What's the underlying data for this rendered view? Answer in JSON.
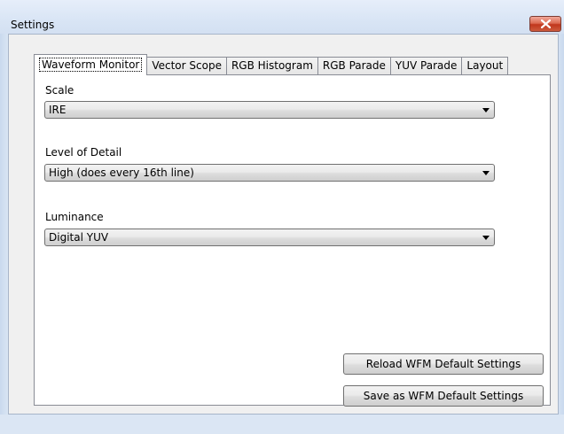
{
  "window": {
    "title": "Settings"
  },
  "tabs": [
    {
      "label": "Waveform Monitor",
      "active": true
    },
    {
      "label": "Vector Scope",
      "active": false
    },
    {
      "label": "RGB Histogram",
      "active": false
    },
    {
      "label": "RGB Parade",
      "active": false
    },
    {
      "label": "YUV Parade",
      "active": false
    },
    {
      "label": "Layout",
      "active": false
    }
  ],
  "fields": {
    "scale": {
      "label": "Scale",
      "value": "IRE"
    },
    "level_of_detail": {
      "label": "Level of Detail",
      "value": "High (does every 16th line)"
    },
    "luminance": {
      "label": "Luminance",
      "value": "Digital YUV"
    }
  },
  "buttons": {
    "reload": "Reload WFM Default Settings",
    "save": "Save as WFM Default Settings"
  },
  "colors": {
    "close_button": "#c1361c",
    "frame": "#dbe6f4",
    "panel": "#ffffff"
  }
}
